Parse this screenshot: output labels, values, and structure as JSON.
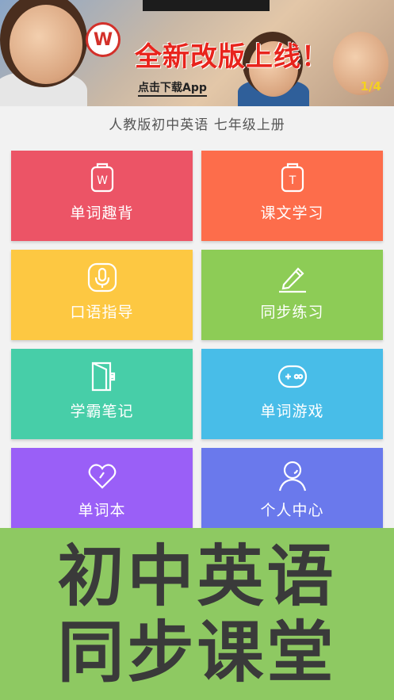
{
  "banner": {
    "headline": "全新改版上线！",
    "download_label": "点击下载App",
    "pager": "1/4",
    "badge_letter": "W"
  },
  "subtitle": "人教版初中英语 七年级上册",
  "tiles": [
    {
      "label": "单词趣背",
      "color": "#ec5466",
      "icon": "word-card-icon",
      "icon_letter": "W"
    },
    {
      "label": "课文学习",
      "color": "#fd6d4b",
      "icon": "text-card-icon",
      "icon_letter": "T"
    },
    {
      "label": "口语指导",
      "color": "#fdc842",
      "icon": "microphone-icon"
    },
    {
      "label": "同步练习",
      "color": "#8dcc56",
      "icon": "pencil-icon"
    },
    {
      "label": "学霸笔记",
      "color": "#47cea8",
      "icon": "notebook-icon"
    },
    {
      "label": "单词游戏",
      "color": "#48bde8",
      "icon": "gamepad-icon"
    },
    {
      "label": "单词本",
      "color": "#9a5ff7",
      "icon": "heart-icon"
    },
    {
      "label": "个人中心",
      "color": "#6a79ec",
      "icon": "user-icon"
    }
  ],
  "promo": {
    "line1": "初中英语",
    "line2": "同步课堂",
    "color": "#8ec962"
  }
}
